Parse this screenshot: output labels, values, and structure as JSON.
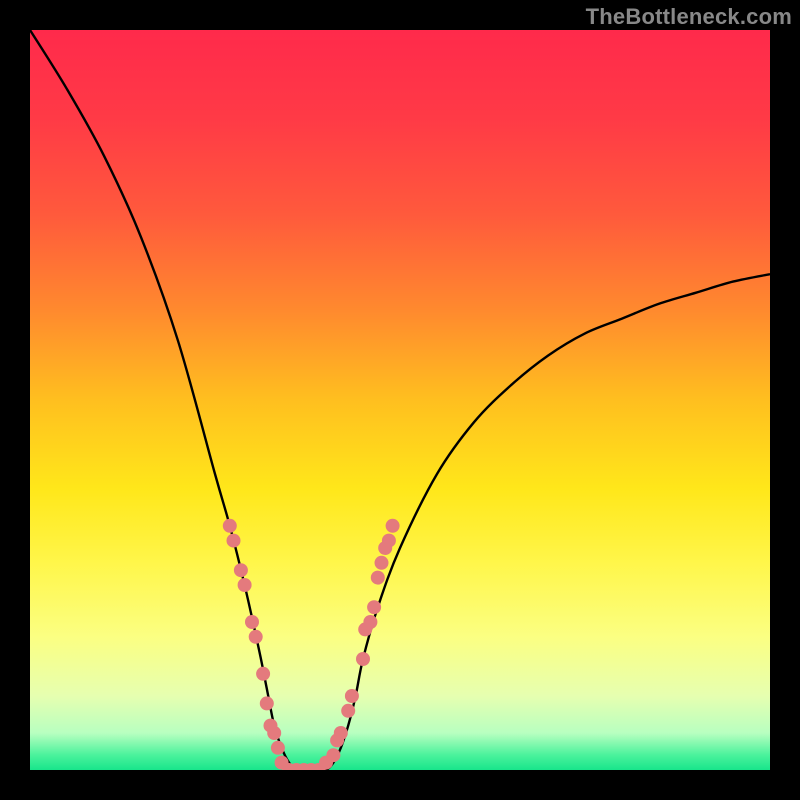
{
  "watermark": "TheBottleneck.com",
  "colors": {
    "black_border": "#000000",
    "curve": "#000000",
    "dot_fill": "#e47a7d",
    "dot_stroke": "#c05b5e"
  },
  "chart_data": {
    "type": "line",
    "title": "",
    "xlabel": "",
    "ylabel": "",
    "xlim": [
      0,
      100
    ],
    "ylim": [
      0,
      100
    ],
    "grid": false,
    "legend": false,
    "gradient_stops": [
      {
        "pos": 0.0,
        "color": "#ff2a4b"
      },
      {
        "pos": 0.12,
        "color": "#ff3a46"
      },
      {
        "pos": 0.25,
        "color": "#ff5a3c"
      },
      {
        "pos": 0.38,
        "color": "#ff8a2e"
      },
      {
        "pos": 0.5,
        "color": "#ffbf1f"
      },
      {
        "pos": 0.62,
        "color": "#ffe71a"
      },
      {
        "pos": 0.72,
        "color": "#fff64a"
      },
      {
        "pos": 0.82,
        "color": "#fbff82"
      },
      {
        "pos": 0.9,
        "color": "#e6ffb0"
      },
      {
        "pos": 0.95,
        "color": "#b8ffc0"
      },
      {
        "pos": 0.98,
        "color": "#4af29c"
      },
      {
        "pos": 1.0,
        "color": "#18e58b"
      }
    ],
    "curve": {
      "description": "Asymmetric V-shaped bottleneck curve. Y = mismatch (100 = worst, 0 = perfect).",
      "x": [
        0,
        5,
        10,
        15,
        20,
        25,
        27,
        29,
        31,
        32,
        33,
        34,
        35,
        36,
        37,
        38,
        39,
        40,
        41,
        42,
        43,
        44,
        45,
        47,
        50,
        55,
        60,
        65,
        70,
        75,
        80,
        85,
        90,
        95,
        100
      ],
      "y": [
        100,
        92,
        83,
        72,
        58,
        40,
        33,
        25,
        16,
        11,
        6,
        3,
        1,
        0,
        0,
        0,
        0,
        0,
        1,
        3,
        6,
        10,
        15,
        22,
        30,
        40,
        47,
        52,
        56,
        59,
        61,
        63,
        64.5,
        66,
        67
      ]
    },
    "dots": {
      "description": "Highlighted scatter points along the curve near the minimum region.",
      "points": [
        {
          "x": 27,
          "y": 33
        },
        {
          "x": 27.5,
          "y": 31
        },
        {
          "x": 28.5,
          "y": 27
        },
        {
          "x": 29,
          "y": 25
        },
        {
          "x": 30,
          "y": 20
        },
        {
          "x": 30.5,
          "y": 18
        },
        {
          "x": 31.5,
          "y": 13
        },
        {
          "x": 32,
          "y": 9
        },
        {
          "x": 32.5,
          "y": 6
        },
        {
          "x": 33,
          "y": 5
        },
        {
          "x": 33.5,
          "y": 3
        },
        {
          "x": 34,
          "y": 1
        },
        {
          "x": 35,
          "y": 0
        },
        {
          "x": 36,
          "y": 0
        },
        {
          "x": 37,
          "y": 0
        },
        {
          "x": 38,
          "y": 0
        },
        {
          "x": 39,
          "y": 0
        },
        {
          "x": 40,
          "y": 1
        },
        {
          "x": 41,
          "y": 2
        },
        {
          "x": 41.5,
          "y": 4
        },
        {
          "x": 42,
          "y": 5
        },
        {
          "x": 43,
          "y": 8
        },
        {
          "x": 43.5,
          "y": 10
        },
        {
          "x": 45,
          "y": 15
        },
        {
          "x": 45.3,
          "y": 19
        },
        {
          "x": 46,
          "y": 20
        },
        {
          "x": 46.5,
          "y": 22
        },
        {
          "x": 47,
          "y": 26
        },
        {
          "x": 47.5,
          "y": 28
        },
        {
          "x": 48,
          "y": 30
        },
        {
          "x": 48.5,
          "y": 31
        },
        {
          "x": 49,
          "y": 33
        }
      ],
      "radius_px": 7
    }
  }
}
